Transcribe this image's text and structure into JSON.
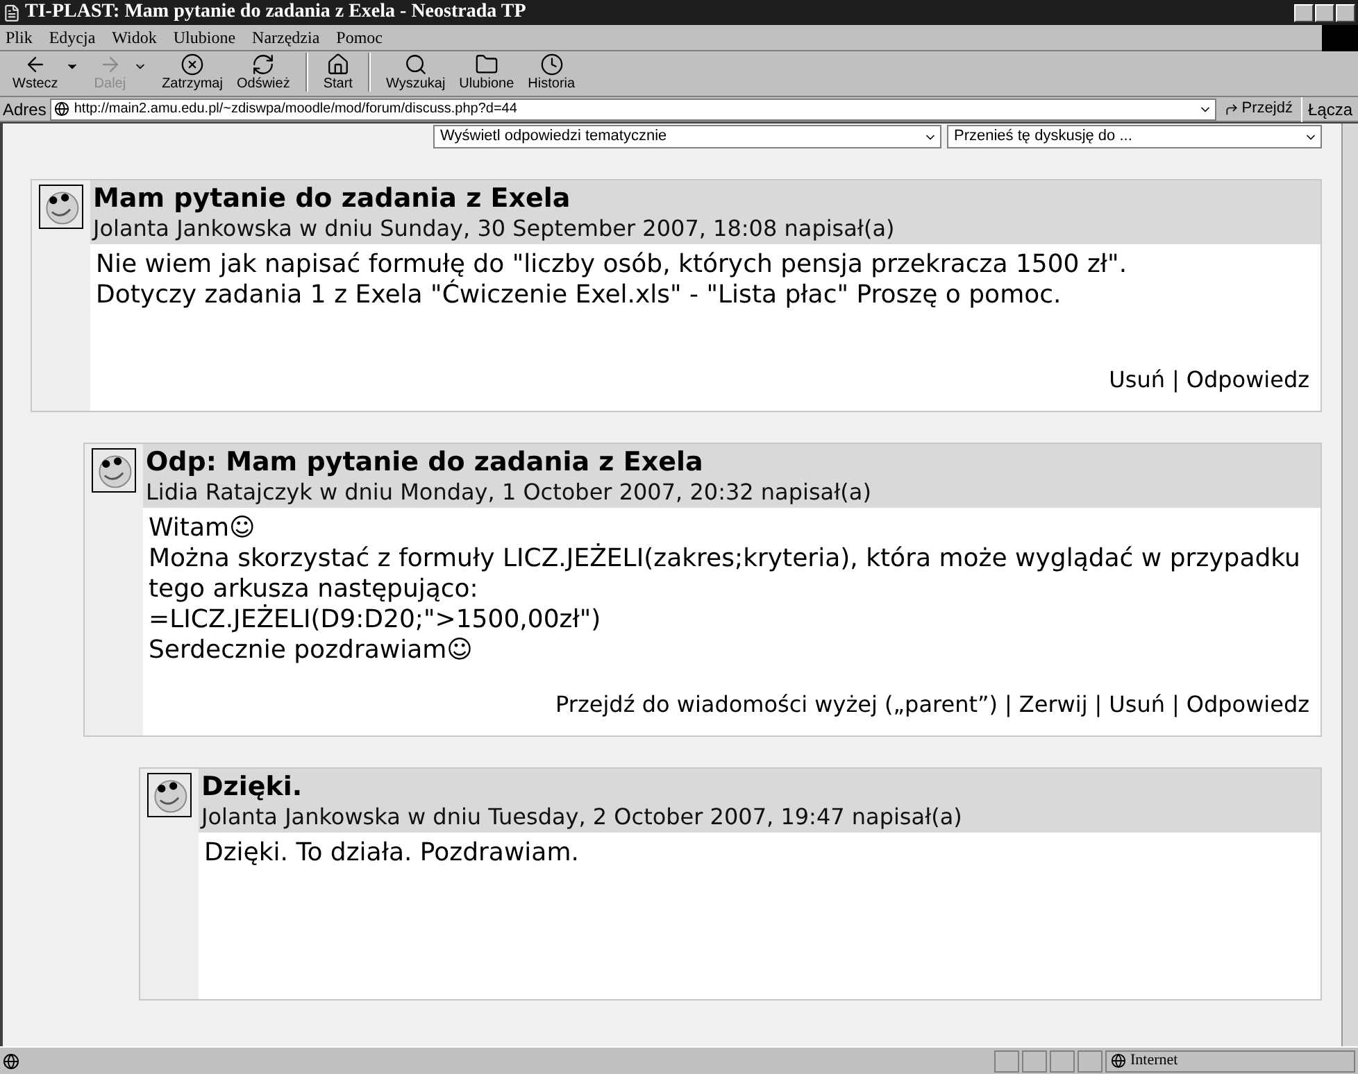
{
  "window": {
    "title": "TI-PLAST: Mam pytanie do zadania z Exela - Neostrada TP"
  },
  "menu": [
    {
      "label": "Plik"
    },
    {
      "label": "Edycja"
    },
    {
      "label": "Widok"
    },
    {
      "label": "Ulubione"
    },
    {
      "label": "Narzędzia"
    },
    {
      "label": "Pomoc"
    }
  ],
  "toolbar": [
    {
      "label": "Wstecz",
      "kind": "back",
      "disabled": false,
      "dropdown": true
    },
    {
      "label": "Dalej",
      "kind": "forward",
      "disabled": true,
      "dropdown": true
    },
    {
      "label": "Zatrzymaj",
      "kind": "stop",
      "disabled": false,
      "dropdown": false
    },
    {
      "label": "Odśwież",
      "kind": "refresh",
      "disabled": false,
      "dropdown": false
    },
    {
      "label": "Start",
      "kind": "home",
      "disabled": false,
      "dropdown": false
    },
    {
      "label": "Wyszukaj",
      "kind": "search",
      "disabled": false,
      "dropdown": false
    },
    {
      "label": "Ulubione",
      "kind": "favorites",
      "disabled": false,
      "dropdown": false
    },
    {
      "label": "Historia",
      "kind": "history",
      "disabled": false,
      "dropdown": false
    }
  ],
  "address_bar": {
    "label": "Adres",
    "value": "http://main2.amu.edu.pl/~zdiswpa/moodle/mod/forum/discuss.php?d=44",
    "go": "Przejdź",
    "links": "Łącza"
  },
  "selects": [
    {
      "value": "Wyświetl odpowiedzi tematycznie"
    },
    {
      "value": "Przenieś tę dyskusję do ..."
    }
  ],
  "posts": [
    {
      "title": "Mam pytanie do zadania z Exela",
      "byline": "Jolanta Jankowska w dniu Sunday, 30 September 2007, 18:08 napisał(a)",
      "body": [
        "Nie wiem jak napisać formułę do \"liczby osób, których pensja przekracza 1500 zł\".",
        "Dotyczy zadania 1 z Exela \"Ćwiczenie Exel.xls\" - \"Lista płac\" Proszę o pomoc."
      ],
      "actions": [
        "Usuń",
        "|",
        "Odpowiedz"
      ]
    },
    {
      "title": "Odp: Mam pytanie do zadania z Exela",
      "byline": "Lidia Ratajczyk w dniu Monday, 1 October 2007, 20:32 napisał(a)",
      "body": [
        "Witam☺",
        "Można skorzystać z formuły LICZ.JEŻELI(zakres;kryteria), która może wyglądać w przypadku tego arkusza następująco:",
        "=LICZ.JEŻELI(D9:D20;\">1500,00zł\")",
        "Serdecznie pozdrawiam☺"
      ],
      "actions": [
        "Przejdź do wiadomości wyżej („parent”)",
        "|",
        "Zerwij",
        "|",
        "Usuń",
        "|",
        "Odpowiedz"
      ]
    },
    {
      "title": "Dzięki.",
      "byline": "Jolanta Jankowska w dniu Tuesday, 2 October 2007, 19:47 napisał(a)",
      "body": [
        "Dzięki. To działa. Pozdrawiam."
      ]
    }
  ],
  "status_bar": {
    "zone": "Internet"
  }
}
